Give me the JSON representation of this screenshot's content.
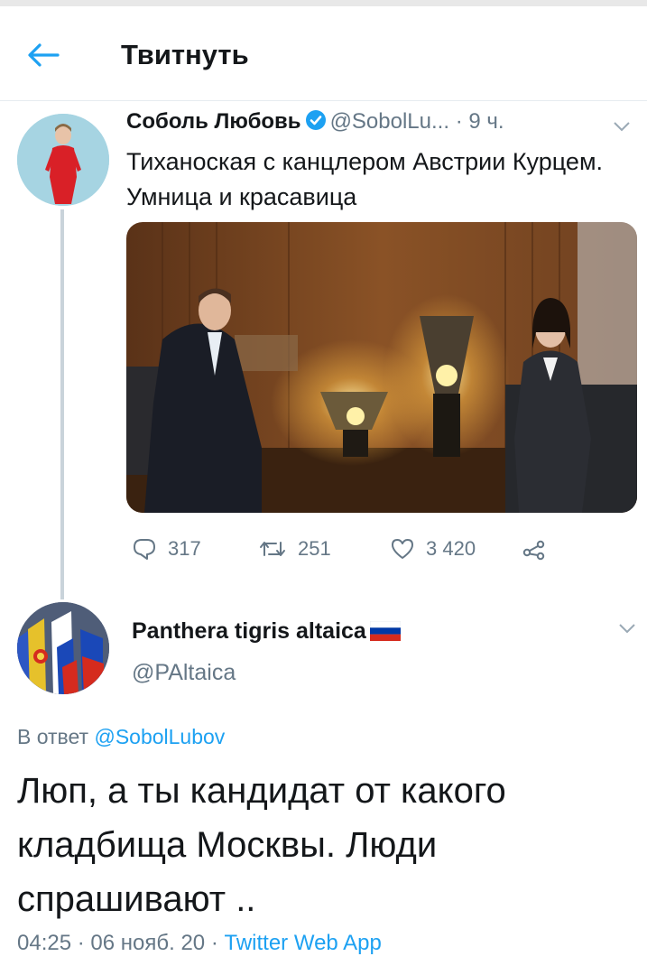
{
  "header": {
    "title": "Твитнуть",
    "back_icon": "arrow-left-icon",
    "accent": "#1da1f2"
  },
  "tweet": {
    "author_name": "Соболь Любовь",
    "verified_icon": "verified-badge-icon",
    "handle": "@SobolLu...",
    "separator": "·",
    "time": "9 ч.",
    "text": "Тиханоская с канцлером Австрии Курцем. Умница и красавица",
    "media_description": "photo",
    "stats": {
      "replies": "317",
      "retweets": "251",
      "likes": "3 420"
    }
  },
  "reply": {
    "author_name": "Panthera tigris altaica",
    "flag_icon": "russian-flag-icon",
    "handle": "@PAltaica",
    "reply_prefix": "В ответ",
    "reply_mention": "@SobolLubov",
    "text": "Люп, а ты кандидат от какого кладбища Москвы. Люди спрашивают ..",
    "time": "04:25",
    "date": "06 нояб. 20",
    "separator": "·",
    "app": "Twitter Web App"
  }
}
